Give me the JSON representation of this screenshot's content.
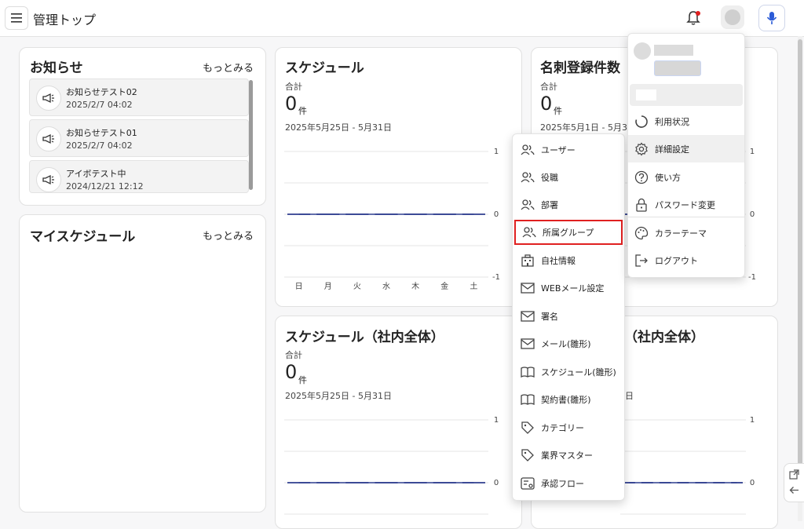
{
  "header": {
    "title": "管理トップ",
    "icons": [
      "hamburger-icon",
      "bell-icon",
      "avatar",
      "microphone-icon"
    ],
    "notification_dot_color": "#e02020"
  },
  "notices": {
    "title": "お知らせ",
    "more": "もっとみる",
    "items": [
      {
        "title": "お知らせテスト02",
        "date": "2025/2/7 04:02"
      },
      {
        "title": "お知らせテスト01",
        "date": "2025/2/7 04:02"
      },
      {
        "title": "アイボテスト中",
        "date": "2024/12/21 12:12"
      }
    ]
  },
  "my_schedule": {
    "title": "マイスケジュール",
    "more": "もっとみる"
  },
  "schedule": {
    "title": "スケジュール",
    "total_label": "合計",
    "count": "0",
    "unit": "件",
    "range": "2025年5月25日 - 5月31日"
  },
  "cards": {
    "title": "名刺登録件数",
    "total_label": "合計",
    "count": "0",
    "unit": "件",
    "range_visible": "2025年5月1日 - 5月31日"
  },
  "schedule_all": {
    "title": "スケジュール（社内全体）",
    "total_label": "合計",
    "count": "0",
    "unit": "件",
    "range": "2025年5月25日 - 5月31日"
  },
  "right_bottom": {
    "title_visible": "（社内全体）",
    "range_fragment": "日"
  },
  "chart_data": [
    {
      "type": "line",
      "categories": [
        "日",
        "月",
        "火",
        "水",
        "木",
        "金",
        "土"
      ],
      "series": [
        {
          "values": [
            0,
            0,
            0,
            0,
            0,
            0,
            0
          ]
        }
      ],
      "yticks": [
        "1",
        "0",
        "-1"
      ],
      "ylim": [
        -1,
        1
      ],
      "color": "#2f3e8f"
    },
    {
      "type": "line",
      "series": [
        {
          "values": [
            0,
            0,
            0,
            0,
            0,
            0,
            0
          ]
        }
      ],
      "yticks": [
        "1",
        "0",
        "-1"
      ],
      "ylim": [
        -1,
        1
      ],
      "color": "#2f3e8f"
    },
    {
      "type": "line",
      "series": [
        {
          "values": [
            0,
            0,
            0,
            0,
            0,
            0,
            0
          ]
        }
      ],
      "yticks": [
        "1",
        "0"
      ],
      "ylim": [
        -1,
        1
      ],
      "color": "#2f3e8f"
    },
    {
      "type": "line",
      "series": [
        {
          "values": [
            0,
            0,
            0,
            0,
            0,
            0,
            0
          ]
        }
      ],
      "yticks": [
        "1",
        "0"
      ],
      "ylim": [
        -1,
        1
      ],
      "color": "#2f3e8f"
    }
  ],
  "settings_menu": {
    "items": [
      {
        "label": "ユーザー",
        "icon": "users-icon"
      },
      {
        "label": "役職",
        "icon": "users-icon"
      },
      {
        "label": "部署",
        "icon": "users-icon"
      },
      {
        "label": "所属グループ",
        "icon": "users-icon",
        "highlighted": true
      },
      {
        "label": "自社情報",
        "icon": "building-icon"
      },
      {
        "label": "WEBメール設定",
        "icon": "mail-icon"
      },
      {
        "label": "署名",
        "icon": "mail-icon"
      },
      {
        "label": "メール(雛形)",
        "icon": "mail-icon"
      },
      {
        "label": "スケジュール(雛形)",
        "icon": "book-icon"
      },
      {
        "label": "契約書(雛形)",
        "icon": "book-icon"
      },
      {
        "label": "カテゴリー",
        "icon": "tag-icon"
      },
      {
        "label": "業界マスター",
        "icon": "tag-icon"
      },
      {
        "label": "承認フロー",
        "icon": "flow-icon"
      }
    ],
    "highlight_color": "#e02020"
  },
  "user_menu": {
    "items": [
      {
        "label": "利用状況",
        "icon": "usage-icon"
      },
      {
        "label": "詳細設定",
        "icon": "gear-icon"
      },
      {
        "label": "使い方",
        "icon": "help-icon"
      },
      {
        "label": "パスワード変更",
        "icon": "lock-icon"
      },
      {
        "label": "カラーテーマ",
        "icon": "palette-icon"
      },
      {
        "label": "ログアウト",
        "icon": "logout-icon"
      }
    ]
  }
}
